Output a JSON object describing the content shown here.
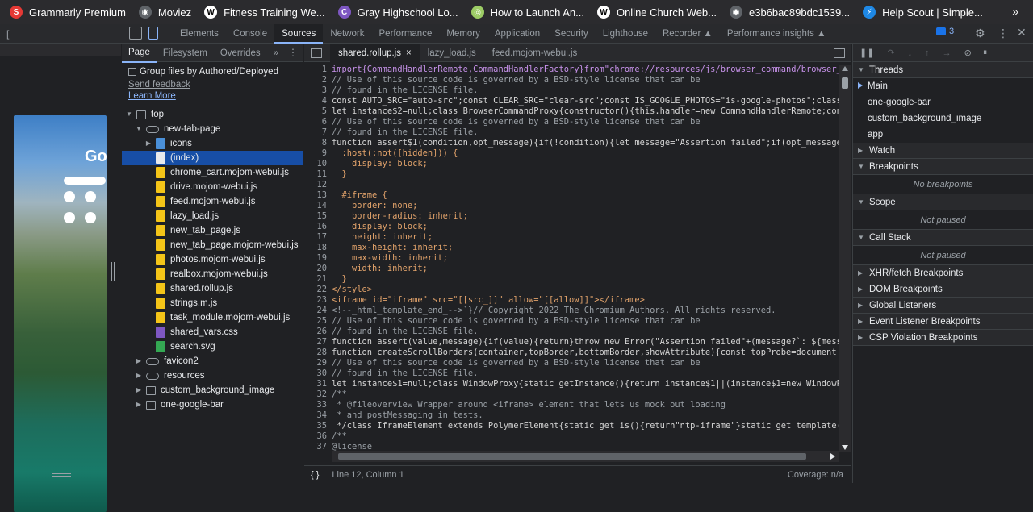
{
  "bookmarks": [
    {
      "label": "Grammarly Premium",
      "icon": "grammarly-icon",
      "color": "#e53935",
      "glyph": "S"
    },
    {
      "label": "Moviez",
      "icon": "globe-icon",
      "color": "#5f6368",
      "glyph": "◉"
    },
    {
      "label": "Fitness Training We...",
      "icon": "wix-icon",
      "color": "#ffffff",
      "glyph": "W"
    },
    {
      "label": "Gray Highschool Lo...",
      "icon": "school-icon",
      "color": "#7e57c2",
      "glyph": "C"
    },
    {
      "label": "How to Launch An...",
      "icon": "notes-icon",
      "color": "#9ccc65",
      "glyph": "◎"
    },
    {
      "label": "Online Church Web...",
      "icon": "wix-icon",
      "color": "#ffffff",
      "glyph": "W"
    },
    {
      "label": "e3b6bac89bdc1539...",
      "icon": "globe-icon",
      "color": "#5f6368",
      "glyph": "◉"
    },
    {
      "label": "Help Scout | Simple...",
      "icon": "helpscout-icon",
      "color": "#1e88e5",
      "glyph": "⚡"
    }
  ],
  "bookmarks_more": "»",
  "device": {
    "width": "114",
    "height": "491"
  },
  "devtools_tabs": [
    "Elements",
    "Console",
    "Sources",
    "Network",
    "Performance",
    "Memory",
    "Application",
    "Security",
    "Lighthouse",
    "Recorder ▲",
    "Performance insights ▲"
  ],
  "active_devtools_tab": "Sources",
  "issues_count": "3",
  "navigator": {
    "tabs": [
      "Page",
      "Filesystem",
      "Overrides",
      "»"
    ],
    "group_label": "Group files by Authored/Deployed",
    "send_feedback": "Send feedback",
    "learn_more": "Learn More",
    "tree": [
      {
        "label": "top",
        "indent": 0,
        "arrow": "▼",
        "type": "frame"
      },
      {
        "label": "new-tab-page",
        "indent": 1,
        "arrow": "▼",
        "type": "cloud"
      },
      {
        "label": "icons",
        "indent": 2,
        "arrow": "▶",
        "type": "folder"
      },
      {
        "label": "(index)",
        "indent": 2,
        "arrow": "",
        "type": "doc",
        "selected": true
      },
      {
        "label": "chrome_cart.mojom-webui.js",
        "indent": 2,
        "arrow": "",
        "type": "js"
      },
      {
        "label": "drive.mojom-webui.js",
        "indent": 2,
        "arrow": "",
        "type": "js"
      },
      {
        "label": "feed.mojom-webui.js",
        "indent": 2,
        "arrow": "",
        "type": "js"
      },
      {
        "label": "lazy_load.js",
        "indent": 2,
        "arrow": "",
        "type": "js"
      },
      {
        "label": "new_tab_page.js",
        "indent": 2,
        "arrow": "",
        "type": "js"
      },
      {
        "label": "new_tab_page.mojom-webui.js",
        "indent": 2,
        "arrow": "",
        "type": "js"
      },
      {
        "label": "photos.mojom-webui.js",
        "indent": 2,
        "arrow": "",
        "type": "js"
      },
      {
        "label": "realbox.mojom-webui.js",
        "indent": 2,
        "arrow": "",
        "type": "js"
      },
      {
        "label": "shared.rollup.js",
        "indent": 2,
        "arrow": "",
        "type": "js"
      },
      {
        "label": "strings.m.js",
        "indent": 2,
        "arrow": "",
        "type": "js"
      },
      {
        "label": "task_module.mojom-webui.js",
        "indent": 2,
        "arrow": "",
        "type": "js"
      },
      {
        "label": "shared_vars.css",
        "indent": 2,
        "arrow": "",
        "type": "css"
      },
      {
        "label": "search.svg",
        "indent": 2,
        "arrow": "",
        "type": "svg"
      },
      {
        "label": "favicon2",
        "indent": 1,
        "arrow": "▶",
        "type": "cloud"
      },
      {
        "label": "resources",
        "indent": 1,
        "arrow": "▶",
        "type": "cloud"
      },
      {
        "label": "custom_background_image",
        "indent": 1,
        "arrow": "▶",
        "type": "frame"
      },
      {
        "label": "one-google-bar",
        "indent": 1,
        "arrow": "▶",
        "type": "frame"
      }
    ]
  },
  "editor": {
    "tabs": [
      {
        "label": "shared.rollup.js",
        "closable": true,
        "active": true
      },
      {
        "label": "lazy_load.js",
        "closable": false,
        "active": false
      },
      {
        "label": "feed.mojom-webui.js",
        "closable": false,
        "active": false
      }
    ],
    "close_glyph": "×",
    "lines": [
      {
        "n": "1",
        "t": "import{CommandHandlerRemote,CommandHandlerFactory}from\"chrome://resources/js/browser_command/browser_comm",
        "c": "#c792ea"
      },
      {
        "n": "2",
        "t": "// Use of this source code is governed by a BSD-style license that can be",
        "c": "#9aa0a6"
      },
      {
        "n": "3",
        "t": "// found in the LICENSE file.",
        "c": "#9aa0a6"
      },
      {
        "n": "4",
        "t": "const AUTO_SRC=\"auto-src\";const CLEAR_SRC=\"clear-src\";const IS_GOOGLE_PHOTOS=\"is-google-photos\";class CrA",
        "c": "#d4d4d4"
      },
      {
        "n": "5",
        "t": "let instance$2=null;class BrowserCommandProxy{constructor(){this.handler=new CommandHandlerRemote;const f",
        "c": "#d4d4d4"
      },
      {
        "n": "6",
        "t": "// Use of this source code is governed by a BSD-style license that can be",
        "c": "#9aa0a6"
      },
      {
        "n": "7",
        "t": "// found in the LICENSE file.",
        "c": "#9aa0a6"
      },
      {
        "n": "8",
        "t": "function assert$1(condition,opt_message){if(!condition){let message=\"Assertion failed\";if(opt_message){me",
        "c": "#d4d4d4"
      },
      {
        "n": "9",
        "t": "  :host(:not([hidden])) {",
        "c": "#e2a36b"
      },
      {
        "n": "10",
        "t": "    display: block;",
        "c": "#e2a36b"
      },
      {
        "n": "11",
        "t": "  }",
        "c": "#e2a36b"
      },
      {
        "n": "12",
        "t": "",
        "c": "#d4d4d4"
      },
      {
        "n": "13",
        "t": "  #iframe {",
        "c": "#e2a36b"
      },
      {
        "n": "14",
        "t": "    border: none;",
        "c": "#e2a36b"
      },
      {
        "n": "15",
        "t": "    border-radius: inherit;",
        "c": "#e2a36b"
      },
      {
        "n": "16",
        "t": "    display: block;",
        "c": "#e2a36b"
      },
      {
        "n": "17",
        "t": "    height: inherit;",
        "c": "#e2a36b"
      },
      {
        "n": "18",
        "t": "    max-height: inherit;",
        "c": "#e2a36b"
      },
      {
        "n": "19",
        "t": "    max-width: inherit;",
        "c": "#e2a36b"
      },
      {
        "n": "20",
        "t": "    width: inherit;",
        "c": "#e2a36b"
      },
      {
        "n": "21",
        "t": "  }",
        "c": "#e2a36b"
      },
      {
        "n": "22",
        "t": "</style>",
        "c": "#e2a36b"
      },
      {
        "n": "23",
        "t": "<iframe id=\"iframe\" src=\"[[src_]]\" allow=\"[[allow]]\"></iframe>",
        "c": "#e2a36b"
      },
      {
        "n": "24",
        "t": "<!--_html_template_end_-->`}// Copyright 2022 The Chromium Authors. All rights reserved.",
        "c": "#9aa0a6"
      },
      {
        "n": "25",
        "t": "// Use of this source code is governed by a BSD-style license that can be",
        "c": "#9aa0a6"
      },
      {
        "n": "26",
        "t": "// found in the LICENSE file.",
        "c": "#9aa0a6"
      },
      {
        "n": "27",
        "t": "function assert(value,message){if(value){return}throw new Error(\"Assertion failed\"+(message?`: ${message}",
        "c": "#d4d4d4"
      },
      {
        "n": "28",
        "t": "function createScrollBorders(container,topBorder,bottomBorder,showAttribute){const topProbe=document.crea",
        "c": "#d4d4d4"
      },
      {
        "n": "29",
        "t": "// Use of this source code is governed by a BSD-style license that can be",
        "c": "#9aa0a6"
      },
      {
        "n": "30",
        "t": "// found in the LICENSE file.",
        "c": "#9aa0a6"
      },
      {
        "n": "31",
        "t": "let instance$1=null;class WindowProxy{static getInstance(){return instance$1||(instance$1=new WindowProxy",
        "c": "#d4d4d4"
      },
      {
        "n": "32",
        "t": "/**",
        "c": "#9aa0a6"
      },
      {
        "n": "33",
        "t": " * @fileoverview Wrapper around <iframe> element that lets us mock out loading",
        "c": "#9aa0a6"
      },
      {
        "n": "34",
        "t": " * and postMessaging in tests.",
        "c": "#9aa0a6"
      },
      {
        "n": "35",
        "t": " */class IframeElement extends PolymerElement{static get is(){return\"ntp-iframe\"}static get template(){re",
        "c": "#d4d4d4"
      },
      {
        "n": "36",
        "t": "/**",
        "c": "#9aa0a6"
      },
      {
        "n": "37",
        "t": "@license",
        "c": "#9aa0a6"
      }
    ],
    "status_left": "{ }",
    "status_position": "Line 12, Column 1",
    "status_coverage": "Coverage: n/a"
  },
  "debugger": {
    "sections": [
      {
        "label": "Threads",
        "open": true,
        "items": [
          "Main",
          "one-google-bar",
          "custom_background_image",
          "app"
        ]
      },
      {
        "label": "Watch",
        "open": false,
        "items": []
      },
      {
        "label": "Breakpoints",
        "open": true,
        "empty": "No breakpoints"
      },
      {
        "label": "Scope",
        "open": true,
        "empty": "Not paused"
      },
      {
        "label": "Call Stack",
        "open": true,
        "empty": "Not paused"
      },
      {
        "label": "XHR/fetch Breakpoints",
        "open": false,
        "items": []
      },
      {
        "label": "DOM Breakpoints",
        "open": false,
        "items": []
      },
      {
        "label": "Global Listeners",
        "open": false,
        "items": []
      },
      {
        "label": "Event Listener Breakpoints",
        "open": false,
        "items": []
      },
      {
        "label": "CSP Violation Breakpoints",
        "open": false,
        "items": []
      }
    ]
  },
  "colors": {
    "accent": "#8ab4f8",
    "selected_row": "#174ea6",
    "folder": "#4a90d9",
    "js": "#f5c518",
    "css": "#7e57c2",
    "svg": "#34a853"
  }
}
